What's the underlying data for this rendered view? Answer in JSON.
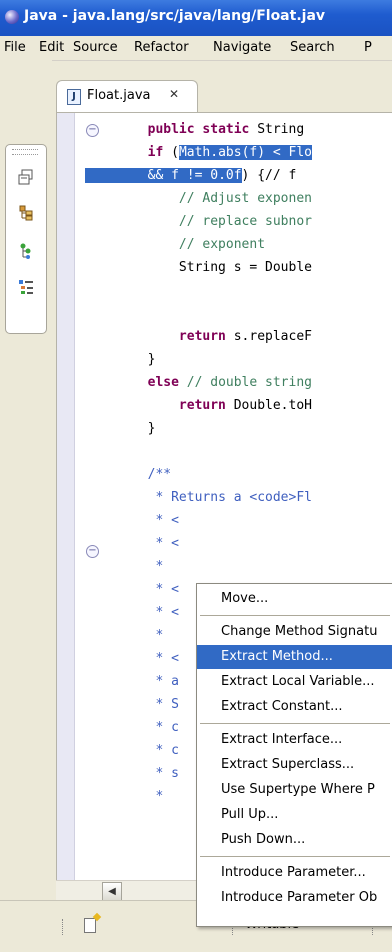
{
  "window": {
    "title": "Java - java.lang/src/java/lang/Float.jav"
  },
  "menu": [
    "File",
    "Edit",
    "Source",
    "Refactor",
    "Navigate",
    "Search",
    "P"
  ],
  "left_toolbar": {
    "icons": [
      "hierarchy-icon",
      "type-hierarchy-icon",
      "package-explorer-icon",
      "outline-icon"
    ]
  },
  "editor": {
    "tab": {
      "label": "Float.java",
      "close": "✕",
      "icon": "J"
    },
    "code": [
      {
        "segs": [
          {
            "t": "        "
          },
          {
            "t": "public static",
            "k": "kw"
          },
          {
            "t": " String"
          }
        ]
      },
      {
        "segs": [
          {
            "t": "        "
          },
          {
            "t": "if",
            "k": "kw"
          },
          {
            "t": " ("
          },
          {
            "t": "Math.",
            "k": "sel"
          },
          {
            "t": "abs",
            "k": "sel"
          },
          {
            "t": "(f) < Flo",
            "k": "sel"
          }
        ]
      },
      {
        "segs": [
          {
            "t": "        ",
            "k": "sel"
          },
          {
            "t": "&& f != 0.0f",
            "k": "sel"
          },
          {
            "t": ") {// f"
          }
        ]
      },
      {
        "segs": [
          {
            "t": "            "
          },
          {
            "t": "// Adjust exponen",
            "k": "cm"
          }
        ]
      },
      {
        "segs": [
          {
            "t": "            "
          },
          {
            "t": "// replace subnor",
            "k": "cm"
          }
        ]
      },
      {
        "segs": [
          {
            "t": "            "
          },
          {
            "t": "// exponent",
            "k": "cm"
          }
        ]
      },
      {
        "segs": [
          {
            "t": "            String s = Double"
          }
        ]
      },
      {
        "segs": [
          {
            "t": ""
          }
        ]
      },
      {
        "segs": [
          {
            "t": ""
          }
        ]
      },
      {
        "segs": [
          {
            "t": "            "
          },
          {
            "t": "return",
            "k": "kw"
          },
          {
            "t": " s.replaceF"
          }
        ]
      },
      {
        "segs": [
          {
            "t": "        }"
          }
        ]
      },
      {
        "segs": [
          {
            "t": "        "
          },
          {
            "t": "else",
            "k": "kw"
          },
          {
            "t": " "
          },
          {
            "t": "// double string",
            "k": "cm"
          }
        ]
      },
      {
        "segs": [
          {
            "t": "            "
          },
          {
            "t": "return",
            "k": "kw"
          },
          {
            "t": " Double.toH"
          }
        ]
      },
      {
        "segs": [
          {
            "t": "        }"
          }
        ]
      },
      {
        "segs": [
          {
            "t": ""
          }
        ]
      },
      {
        "segs": [
          {
            "t": "        "
          },
          {
            "t": "/**",
            "k": "jd"
          }
        ]
      },
      {
        "segs": [
          {
            "t": "         "
          },
          {
            "t": "* Returns a <code>Fl",
            "k": "jd"
          }
        ]
      },
      {
        "segs": [
          {
            "t": "         "
          },
          {
            "t": "* <",
            "k": "jd"
          }
        ]
      },
      {
        "segs": [
          {
            "t": "         "
          },
          {
            "t": "* <",
            "k": "jd"
          }
        ]
      },
      {
        "segs": [
          {
            "t": "         "
          },
          {
            "t": "*",
            "k": "jd"
          }
        ]
      },
      {
        "segs": [
          {
            "t": "         "
          },
          {
            "t": "* <",
            "k": "jd"
          }
        ]
      },
      {
        "segs": [
          {
            "t": "         "
          },
          {
            "t": "* <",
            "k": "jd"
          }
        ]
      },
      {
        "segs": [
          {
            "t": "         "
          },
          {
            "t": "*",
            "k": "jd"
          }
        ]
      },
      {
        "segs": [
          {
            "t": "         "
          },
          {
            "t": "* <",
            "k": "jd"
          }
        ]
      },
      {
        "segs": [
          {
            "t": "         "
          },
          {
            "t": "* a",
            "k": "jd"
          }
        ]
      },
      {
        "segs": [
          {
            "t": "         "
          },
          {
            "t": "* S",
            "k": "jd"
          }
        ]
      },
      {
        "segs": [
          {
            "t": "         "
          },
          {
            "t": "* c",
            "k": "jd"
          }
        ]
      },
      {
        "segs": [
          {
            "t": "         "
          },
          {
            "t": "* c",
            "k": "jd"
          }
        ]
      },
      {
        "segs": [
          {
            "t": "         "
          },
          {
            "t": "* s",
            "k": "jd"
          }
        ]
      },
      {
        "segs": [
          {
            "t": "         "
          },
          {
            "t": "*",
            "k": "jd"
          }
        ]
      }
    ]
  },
  "context_menu": {
    "items": [
      {
        "label": "Move...",
        "highlight": false,
        "sep_after": true
      },
      {
        "label": "Change Method Signatu",
        "highlight": false,
        "sep_after": false
      },
      {
        "label": "Extract Method...",
        "highlight": true,
        "sep_after": false
      },
      {
        "label": "Extract Local Variable...",
        "highlight": false,
        "sep_after": false
      },
      {
        "label": "Extract Constant...",
        "highlight": false,
        "sep_after": true
      },
      {
        "label": "Extract Interface...",
        "highlight": false,
        "sep_after": false
      },
      {
        "label": "Extract Superclass...",
        "highlight": false,
        "sep_after": false
      },
      {
        "label": "Use Supertype Where P",
        "highlight": false,
        "sep_after": false
      },
      {
        "label": "Pull Up...",
        "highlight": false,
        "sep_after": false
      },
      {
        "label": "Push Down...",
        "highlight": false,
        "sep_after": true
      },
      {
        "label": "Introduce Parameter...",
        "highlight": false,
        "sep_after": false
      },
      {
        "label": "Introduce Parameter Ob",
        "highlight": false,
        "sep_after": false
      }
    ]
  },
  "status": {
    "writable": "Writable"
  },
  "colors": {
    "selection": "#316ac5",
    "keyword": "#7f0055",
    "comment": "#3f7f5f",
    "javadoc": "#3f5fbf"
  }
}
